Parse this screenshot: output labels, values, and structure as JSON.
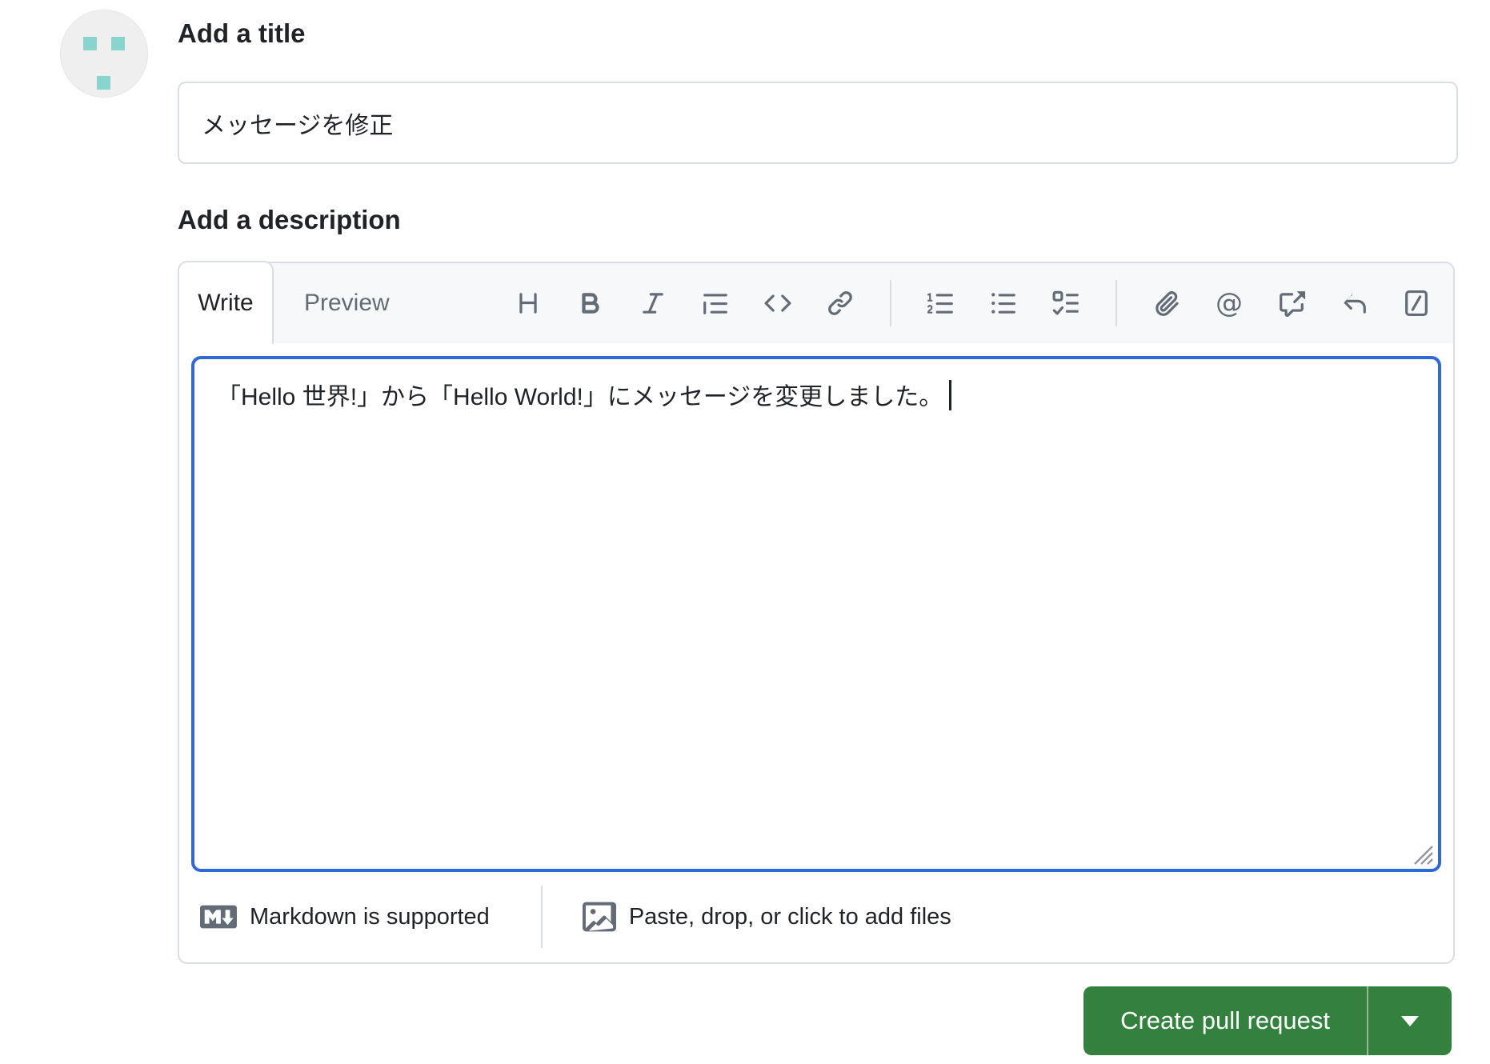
{
  "avatar": {
    "type": "identicon",
    "background": "#efeff0",
    "square_color": "#89d4cd"
  },
  "form": {
    "title_label": "Add a title",
    "title_value": "メッセージを修正",
    "description_label": "Add a description"
  },
  "editor": {
    "tabs": [
      {
        "label": "Write",
        "active": true
      },
      {
        "label": "Preview",
        "active": false
      }
    ],
    "toolbar_icons": [
      "heading-icon",
      "bold-icon",
      "italic-icon",
      "quote-icon",
      "code-icon",
      "link-icon",
      "ordered-list-icon",
      "unordered-list-icon",
      "tasklist-icon",
      "paperclip-icon",
      "mention-icon",
      "cross-reference-icon",
      "reply-icon",
      "slash-command-icon"
    ],
    "mention_glyph": "@",
    "body_text": "「Hello 世界!」から「Hello World!」にメッセージを変更しました。",
    "footer": {
      "markdown_icon": "markdown-icon",
      "markdown_note": "Markdown is supported",
      "image_icon": "image-icon",
      "paste_note": "Paste, drop, or click to add files"
    }
  },
  "actions": {
    "create_button_label": "Create pull request",
    "dropdown_icon": "caret-down-icon"
  },
  "colors": {
    "accent_blue": "#3069d6",
    "button_green": "#34813f",
    "border": "#d8dee4",
    "muted_text": "#636c76",
    "header_bg": "#f6f8fa"
  }
}
